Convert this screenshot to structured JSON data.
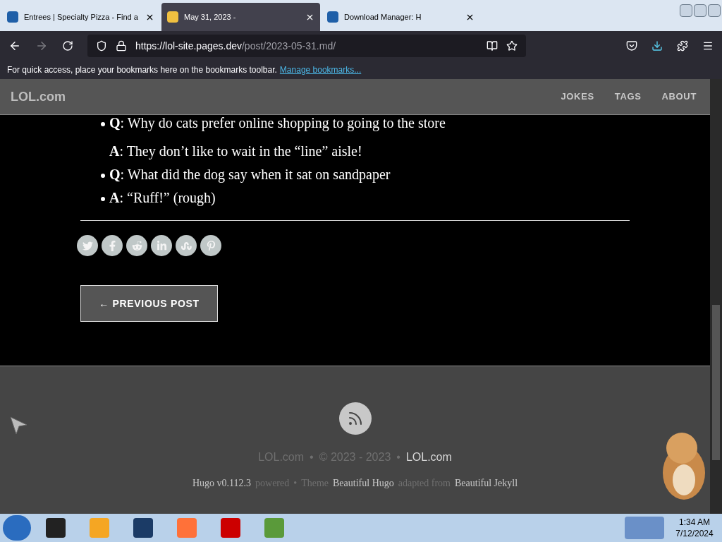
{
  "browser": {
    "tabs": [
      {
        "title": "Entrees | Specialty Pizza - Find a",
        "selected": false
      },
      {
        "title": "May 31, 2023 -",
        "selected": true
      },
      {
        "title": "Download Manager: H",
        "selected": false
      }
    ],
    "url": {
      "host": "https://lol-site.pages.dev",
      "path": "/post/2023-05-31.md/"
    },
    "bookmarks_bar": {
      "text": "For quick access, place your bookmarks here on the bookmarks toolbar.",
      "link": "Manage bookmarks..."
    }
  },
  "site": {
    "brand": "LOL.com",
    "nav": [
      "JOKES",
      "TAGS",
      "ABOUT"
    ],
    "items": [
      {
        "paragraphs": [
          "**Q**: Why do cats prefer online shopping to going to the store",
          "**A**: They don’t like to wait in the “line” aisle!"
        ]
      },
      {
        "paragraphs": [
          "**Q**: What did the dog say when it sat on sandpaper"
        ]
      },
      {
        "paragraphs": [
          "**A**: “Ruff!” (rough)"
        ]
      }
    ],
    "share": [
      {
        "kind": "twitter"
      },
      {
        "kind": "facebook"
      },
      {
        "kind": "reddit"
      },
      {
        "kind": "linkedin"
      },
      {
        "kind": "stumbleupon"
      },
      {
        "kind": "pinterest"
      }
    ],
    "previous_button": "← PREVIOUS POST",
    "footer": {
      "copyright": [
        {
          "text": "LOL.com",
          "bright": false
        },
        {
          "text": "•",
          "bright": false
        },
        {
          "text": "© 2023 - 2023",
          "bright": false
        },
        {
          "text": "•",
          "bright": false
        },
        {
          "text": "LOL.com",
          "bright": true
        }
      ],
      "credits": [
        {
          "text": "Hugo v0.112.3",
          "bright": true
        },
        {
          "text": "powered",
          "bright": false
        },
        {
          "text": "•",
          "bright": false
        },
        {
          "text": "Theme",
          "bright": false
        },
        {
          "text": "Beautiful Hugo",
          "bright": true
        },
        {
          "text": "adapted from",
          "bright": false
        },
        {
          "text": "Beautiful Jekyll",
          "bright": true
        }
      ]
    }
  },
  "taskbar": {
    "time": "1:34 AM",
    "date": "7/12/2024"
  }
}
